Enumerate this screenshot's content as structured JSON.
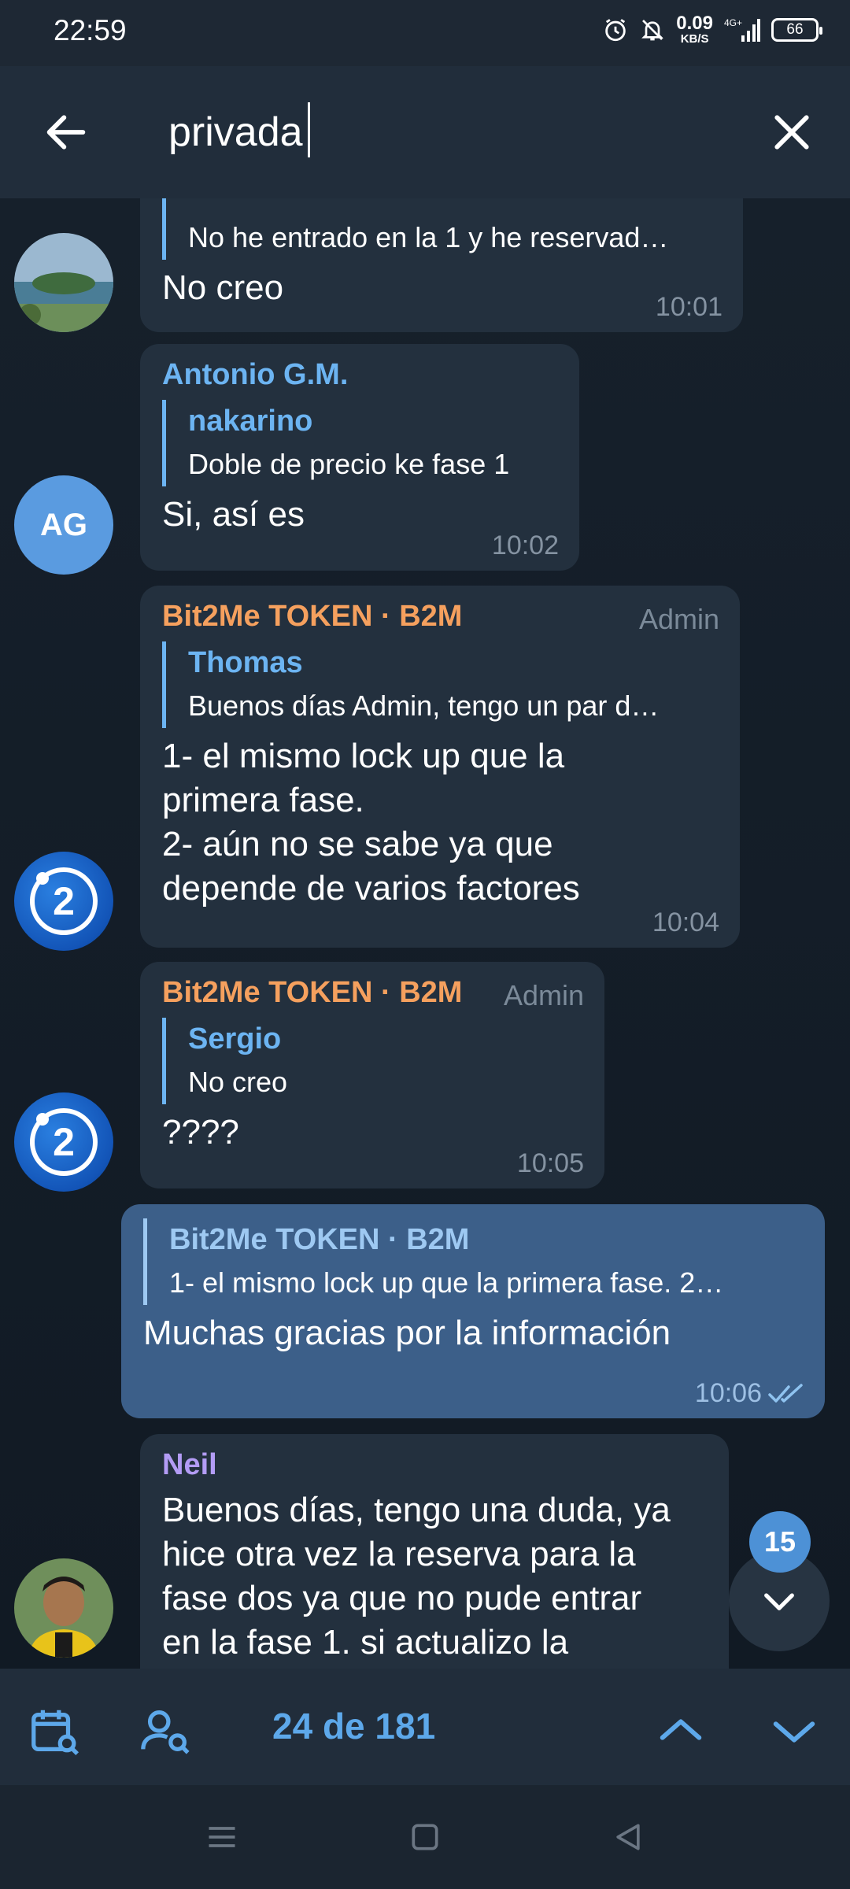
{
  "status_bar": {
    "time": "22:59",
    "net_speed_value": "0.09",
    "net_speed_unit": "KB/S",
    "network": "4G+",
    "battery": "66"
  },
  "search": {
    "query": "privada"
  },
  "messages": [
    {
      "quote_text": "No he entrado en la 1 y he reservad…",
      "text": "No creo",
      "time": "10:01"
    },
    {
      "sender": "Antonio G.M.",
      "avatar_initials": "AG",
      "quote_name": "nakarino",
      "quote_text": "Doble de precio ke fase 1",
      "text": "Si, así es",
      "time": "10:02"
    },
    {
      "sender": "Bit2Me TOKEN · B2M",
      "role": "Admin",
      "quote_name": "Thomas",
      "quote_text": "Buenos días Admin, tengo un par d…",
      "text_lines": [
        "1- el mismo lock up que la",
        "primera fase.",
        "2- aún no se sabe ya que",
        "depende de varios factores"
      ],
      "time": "10:04"
    },
    {
      "sender": "Bit2Me TOKEN · B2M",
      "role": "Admin",
      "quote_name": "Sergio",
      "quote_text": "No creo",
      "text": "????",
      "time": "10:05"
    },
    {
      "quote_name": "Bit2Me TOKEN · B2M",
      "quote_text": "1- el mismo lock up que la primera fase. 2…",
      "text": "Muchas gracias por la información",
      "time": "10:06"
    },
    {
      "sender": "Neil",
      "text_lines": [
        "Buenos días, tengo una duda, ya",
        "hice otra vez la reserva para la",
        "fase dos ya que no pude entrar",
        "en la fase 1. si actualizo la"
      ]
    }
  ],
  "unread_badge": "15",
  "search_nav": {
    "counter": "24 de 181"
  },
  "colors": {
    "background": "#1d2733",
    "bubble_in": "#23303e",
    "bubble_out": "#3c5f89",
    "accent": "#5da8ea",
    "admin_sender": "#f5a05e"
  }
}
